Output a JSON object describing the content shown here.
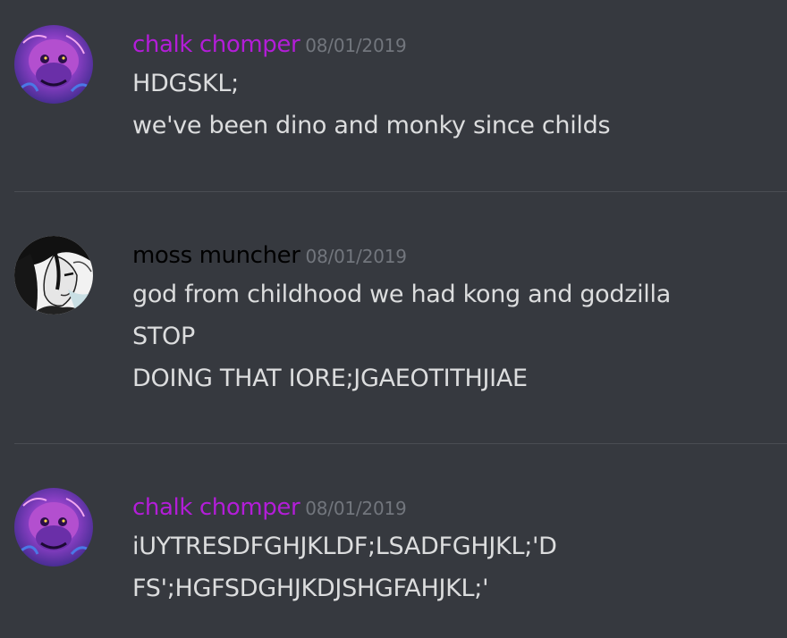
{
  "messages": [
    {
      "username": "chalk chomper",
      "username_color": "#b31dd8",
      "timestamp": "08/01/2019",
      "avatar_icon": "purple-gorilla-avatar",
      "lines": [
        "HDGSKL;",
        "we've been dino and monky since childs"
      ]
    },
    {
      "username": "moss muncher",
      "username_color": "#000000",
      "timestamp": "08/01/2019",
      "avatar_icon": "anime-character-avatar",
      "lines": [
        "god from childhood we had kong and godzilla",
        "STOP",
        "DOING THAT IORE;JGAEOTITHJIAE"
      ]
    },
    {
      "username": "chalk chomper",
      "username_color": "#b31dd8",
      "timestamp": "08/01/2019",
      "avatar_icon": "purple-gorilla-avatar",
      "lines": [
        "iUYTRESDFGHJKLDF;LSADFGHJKL;'D",
        "FS';HGFSDGHJKDJSHGFAHJKL;'"
      ]
    }
  ]
}
